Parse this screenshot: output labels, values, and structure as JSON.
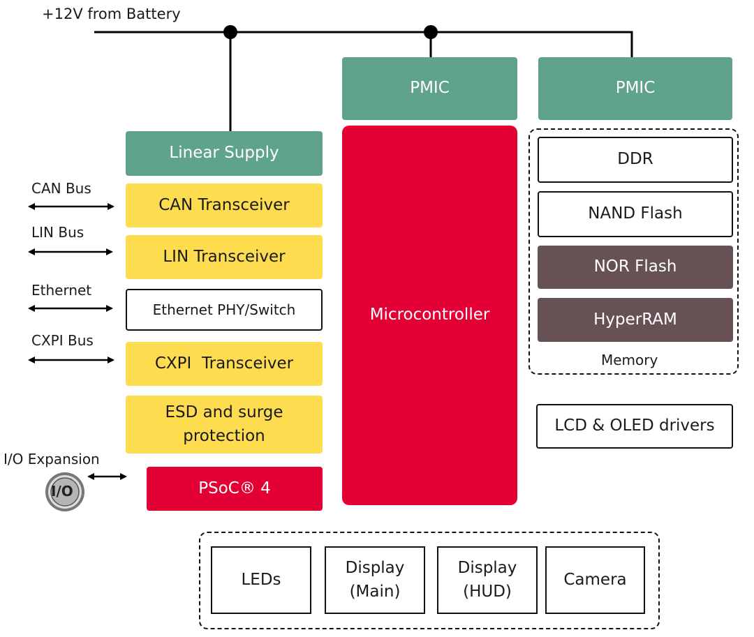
{
  "supply_label": "+12V from Battery",
  "colors": {
    "power": "#5fa38f",
    "interface": "#fddc4f",
    "controller": "#e30034",
    "memory_dark": "#665155"
  },
  "center": {
    "pmic": "PMIC",
    "microcontroller": "Microcontroller"
  },
  "right": {
    "pmic": "PMIC",
    "memory": {
      "label": "Memory",
      "items": [
        "DDR",
        "NAND Flash",
        "NOR Flash",
        "HyperRAM"
      ]
    },
    "lcd": "LCD & OLED drivers"
  },
  "left": {
    "linear_supply": "Linear Supply",
    "can": {
      "bus": "CAN Bus",
      "block": "CAN Transceiver"
    },
    "lin": {
      "bus": "LIN Bus",
      "block": "LIN Transceiver"
    },
    "ethernet": {
      "bus": "Ethernet",
      "block": "Ethernet PHY/Switch"
    },
    "cxpi": {
      "bus": "CXPI Bus",
      "block": "CXPI  Transceiver"
    },
    "esd": "ESD and surge protection",
    "psoc": "PSoC® 4",
    "io": {
      "label": "I/O Expansion",
      "icon": "I/O"
    }
  },
  "peripherals": [
    "LEDs",
    "Display (Main)",
    "Display (HUD)",
    "Camera"
  ]
}
